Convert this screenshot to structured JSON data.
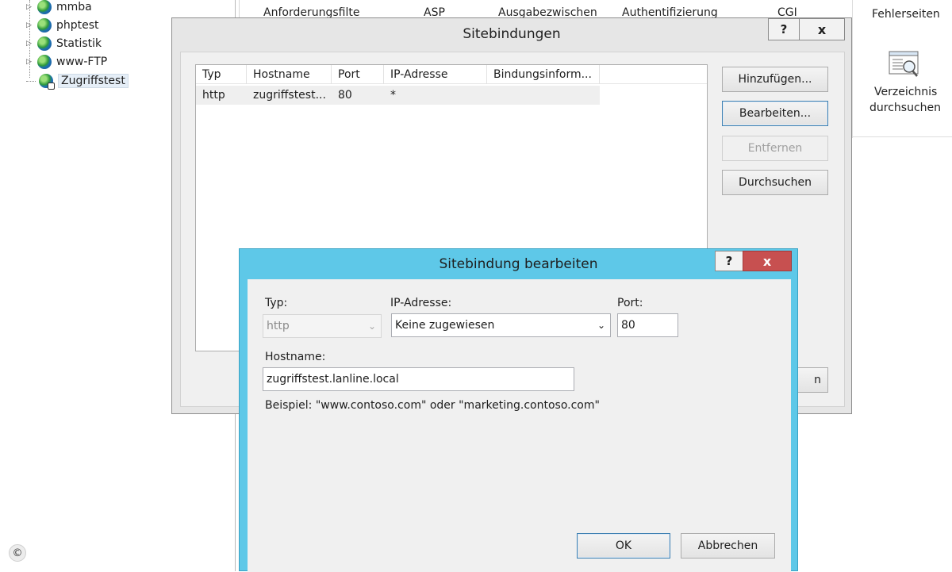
{
  "tree": {
    "items": [
      {
        "label": "mmba"
      },
      {
        "label": "phptest"
      },
      {
        "label": "Statistik"
      },
      {
        "label": "www-FTP"
      },
      {
        "label": "Zugriffstest"
      }
    ]
  },
  "features": {
    "row_top": [
      "Anforderungsfilte",
      "ASP",
      "Ausgabezwischen",
      "Authentifizierung",
      "CGI"
    ]
  },
  "actions": {
    "fehlerseiten": "Fehlerseiten",
    "verzeichnis_line1": "Verzeichnis",
    "verzeichnis_line2": "durchsuchen"
  },
  "sitebindungen": {
    "title": "Sitebindungen",
    "help": "?",
    "close": "x",
    "columns": [
      "Typ",
      "Hostname",
      "Port",
      "IP-Adresse",
      "Bindungsinform..."
    ],
    "rows": [
      {
        "typ": "http",
        "hostname": "zugriffstest...",
        "port": "80",
        "ip": "*",
        "info": ""
      }
    ],
    "buttons": {
      "add": "Hinzufügen...",
      "edit": "Bearbeiten...",
      "remove": "Entfernen",
      "browse": "Durchsuchen",
      "close_partial": "n"
    }
  },
  "edit_dialog": {
    "title": "Sitebindung bearbeiten",
    "help": "?",
    "close": "x",
    "typ_label": "Typ:",
    "typ_value": "http",
    "ip_label": "IP-Adresse:",
    "ip_value": "Keine zugewiesen",
    "port_label": "Port:",
    "port_value": "80",
    "hostname_label": "Hostname:",
    "hostname_value": "zugriffstest.lanline.local",
    "example": "Beispiel: \"www.contoso.com\" oder \"marketing.contoso.com\"",
    "ok": "OK",
    "cancel": "Abbrechen"
  },
  "copyright": "©",
  "colors": {
    "edit_frame": "#5ec8e8",
    "edit_close": "#c75050",
    "outer_frame": "#e6e6e6"
  }
}
